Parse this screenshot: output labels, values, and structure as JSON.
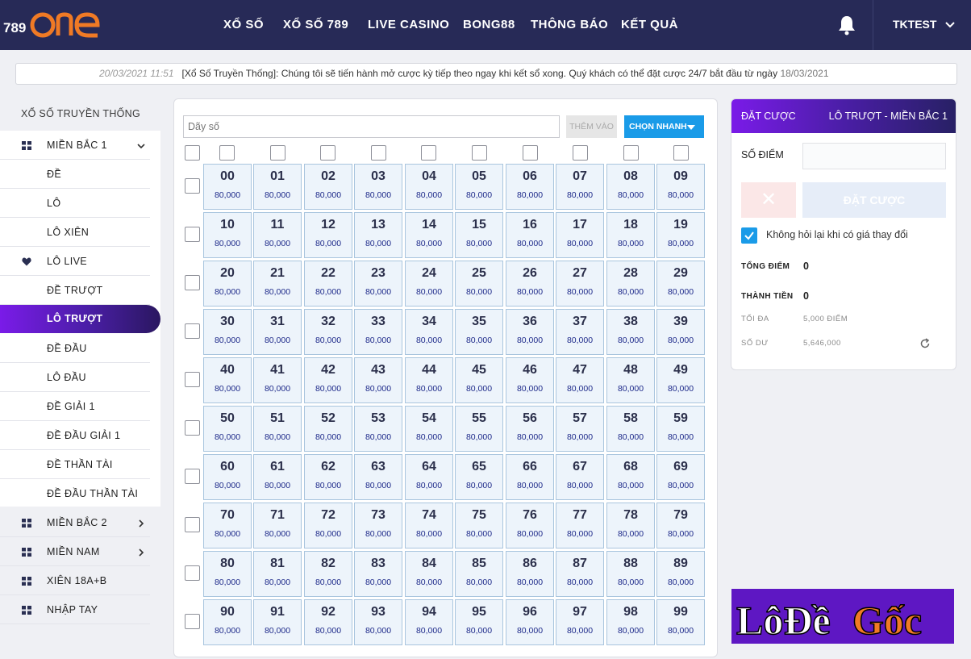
{
  "header": {
    "logo_text": "789 ONE",
    "nav": [
      "XỔ SỐ",
      "XỔ SỐ 789",
      "LIVE CASINO",
      "BONG88",
      "THÔNG BÁO",
      "KẾT QUẢ"
    ],
    "user": "TKTEST"
  },
  "ticker": {
    "time": "20/03/2021 11:51",
    "message": "[Xổ Số Truyền Thống]: Chúng tôi sẽ tiến hành mở cược kỳ tiếp theo ngay khi kết sổ xong. Quý khách có thể đặt cược 24/7 bắt đầu từ ngày",
    "date": "18/03/2021"
  },
  "sidebar": {
    "title": "XỔ SỐ TRUYỀN THỐNG",
    "items": [
      {
        "label": "MIỀN BẮC 1",
        "icon": "grid-icon",
        "chevron": "down"
      },
      {
        "label": "ĐỀ"
      },
      {
        "label": "LÔ"
      },
      {
        "label": "LÔ XIÊN"
      },
      {
        "label": "LÔ LIVE",
        "icon": "heart-icon"
      },
      {
        "label": "ĐỀ TRƯỢT"
      },
      {
        "label": "LÔ TRƯỢT",
        "active": true
      },
      {
        "label": "ĐỀ ĐẦU"
      },
      {
        "label": "LÔ ĐẦU"
      },
      {
        "label": "ĐỀ GIẢI 1"
      },
      {
        "label": "ĐỀ ĐẦU GIẢI 1"
      },
      {
        "label": "ĐỀ THẦN TÀI"
      },
      {
        "label": "ĐỀ ĐẦU THẦN TÀI"
      },
      {
        "label": "MIỀN BẮC 2",
        "icon": "grid-icon",
        "chevron": "right"
      },
      {
        "label": "MIỀN NAM",
        "icon": "grid-icon",
        "chevron": "right"
      },
      {
        "label": "XIÊN 18A+B",
        "icon": "grid-icon"
      },
      {
        "label": "NHẬP TAY",
        "icon": "grid-icon"
      }
    ]
  },
  "main": {
    "number_input_placeholder": "Dãy số",
    "add_label": "THÊM VÀO",
    "quick_label": "CHỌN NHANH",
    "price": "80,000",
    "numbers": [
      "00",
      "01",
      "02",
      "03",
      "04",
      "05",
      "06",
      "07",
      "08",
      "09",
      "10",
      "11",
      "12",
      "13",
      "14",
      "15",
      "16",
      "17",
      "18",
      "19",
      "20",
      "21",
      "22",
      "23",
      "24",
      "25",
      "26",
      "27",
      "28",
      "29",
      "30",
      "31",
      "32",
      "33",
      "34",
      "35",
      "36",
      "37",
      "38",
      "39",
      "40",
      "41",
      "42",
      "43",
      "44",
      "45",
      "46",
      "47",
      "48",
      "49",
      "50",
      "51",
      "52",
      "53",
      "54",
      "55",
      "56",
      "57",
      "58",
      "59",
      "60",
      "61",
      "62",
      "63",
      "64",
      "65",
      "66",
      "67",
      "68",
      "69",
      "70",
      "71",
      "72",
      "73",
      "74",
      "75",
      "76",
      "77",
      "78",
      "79",
      "80",
      "81",
      "82",
      "83",
      "84",
      "85",
      "86",
      "87",
      "88",
      "89",
      "90",
      "91",
      "92",
      "93",
      "94",
      "95",
      "96",
      "97",
      "98",
      "99"
    ]
  },
  "bet": {
    "title": "ĐẶT CƯỢC",
    "type": "LÔ TRƯỢT - MIỀN BẮC 1",
    "score_label": "SỐ ĐIỂM",
    "clear_symbol": "✕",
    "submit_label": "ĐẶT CƯỢC",
    "no_ask_label": "Không hỏi lại khi có giá thay đổi",
    "no_ask_checked": true,
    "total_points_label": "TỔNG ĐIỂM",
    "total_points": "0",
    "total_amount_label": "THÀNH TIỀN",
    "total_amount": "0",
    "max_label": "TỐI ĐA",
    "max_value": "5,000 ĐIỂM",
    "balance_label": "SỐ DƯ",
    "balance_value": "5,646,000"
  },
  "watermark": {
    "text": "LôĐềGốc"
  },
  "colors": {
    "header_bg": "#272a57",
    "accent": "#1a9be8",
    "active_purple": "#7a1be8",
    "logo_orange": "#f07a25"
  }
}
